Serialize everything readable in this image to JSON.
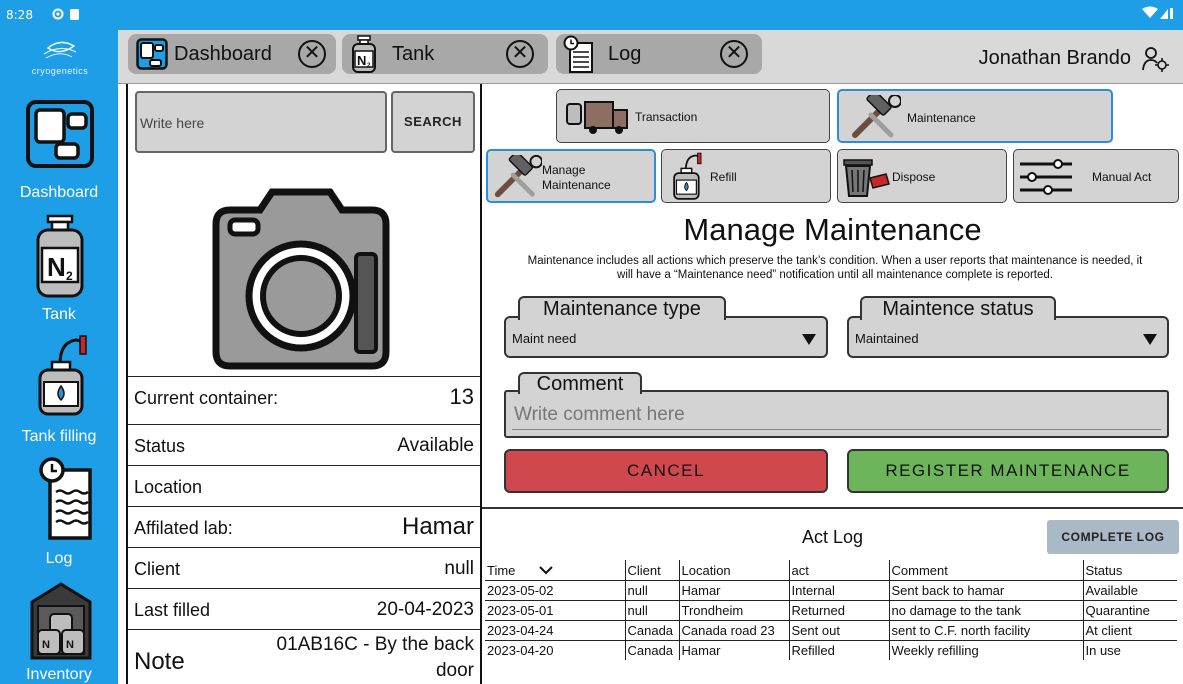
{
  "status_bar": {
    "time": "8:28"
  },
  "sidebar": {
    "logo_text": "cryogenetics",
    "items": [
      {
        "label": "Dashboard",
        "icon": "dashboard-icon"
      },
      {
        "label": "Tank",
        "icon": "nitrogen-tank-icon"
      },
      {
        "label": "Tank filling",
        "icon": "tank-filling-icon"
      },
      {
        "label": "Log",
        "icon": "log-icon"
      },
      {
        "label": "Inventory",
        "icon": "inventory-icon"
      }
    ]
  },
  "tabs": [
    {
      "label": "Dashboard",
      "icon": "dashboard-icon"
    },
    {
      "label": "Tank",
      "icon": "nitrogen-tank-icon"
    },
    {
      "label": "Log",
      "icon": "log-icon"
    }
  ],
  "user": {
    "name": "Jonathan Brando"
  },
  "search": {
    "placeholder": "Write here",
    "button_label": "SEARCH"
  },
  "details": {
    "current_container": {
      "label": "Current container:",
      "value": "13"
    },
    "status": {
      "label": "Status",
      "value": "Available"
    },
    "location": {
      "label": "Location",
      "value": ""
    },
    "affiliated_lab": {
      "label": "Affilated lab:",
      "value": "Hamar"
    },
    "client": {
      "label": "Client",
      "value": "null"
    },
    "last_filled": {
      "label": "Last filled",
      "value": "20-04-2023"
    },
    "note": {
      "label": "Note",
      "value_line1": "01AB16C - By the back",
      "value_line2": "door"
    }
  },
  "actions": {
    "top": [
      {
        "label": "Transaction",
        "icon": "delivery-truck-icon"
      },
      {
        "label": "Maintenance",
        "icon": "tools-icon",
        "selected": true
      }
    ],
    "sub": [
      {
        "label_line1": "Manage",
        "label_line2": "Maintenance",
        "icon": "tools-icon",
        "selected": true
      },
      {
        "label": "Refill",
        "icon": "tank-filling-icon"
      },
      {
        "label": "Dispose",
        "icon": "trash-icon"
      },
      {
        "label": "Manual Act",
        "icon": "sliders-icon"
      }
    ]
  },
  "form": {
    "title": "Manage Maintenance",
    "description_line1": "Maintenance includes all actions which preserve the tank’s condition. When a user reports that maintenance is needed, it",
    "description_line2": "will have a “Maintenance need” notification until all maintenance complete is reported.",
    "maintenance_type": {
      "label": "Maintenance type",
      "value": "Maint need"
    },
    "maintenance_status": {
      "label": "Maintence status",
      "value": "Maintained"
    },
    "comment": {
      "label": "Comment",
      "placeholder": "Write comment here"
    },
    "cancel_label": "CANCEL",
    "register_label": "REGISTER MAINTENANCE"
  },
  "act_log": {
    "title": "Act Log",
    "complete_log_label": "COMPLETE LOG",
    "columns": [
      "Time",
      "Client",
      "Location",
      "act",
      "Comment",
      "Status"
    ],
    "rows": [
      [
        "2023-05-02",
        "null",
        "Hamar",
        "Internal",
        "Sent back to hamar",
        "Available"
      ],
      [
        "2023-05-01",
        "null",
        "Trondheim",
        "Returned",
        "no damage to the tank",
        "Quarantine"
      ],
      [
        "2023-04-24",
        "Canada",
        "Canada road 23",
        "Sent out",
        "sent to C.F. north facility",
        "At client"
      ],
      [
        "2023-04-20",
        "Canada",
        "Hamar",
        "Refilled",
        "Weekly refilling",
        "In use"
      ]
    ]
  },
  "colors": {
    "brand_blue": "#1d9ee6",
    "cancel_red": "#d1474e",
    "register_green": "#6db55b",
    "selected_outline": "#2a8fd6"
  }
}
